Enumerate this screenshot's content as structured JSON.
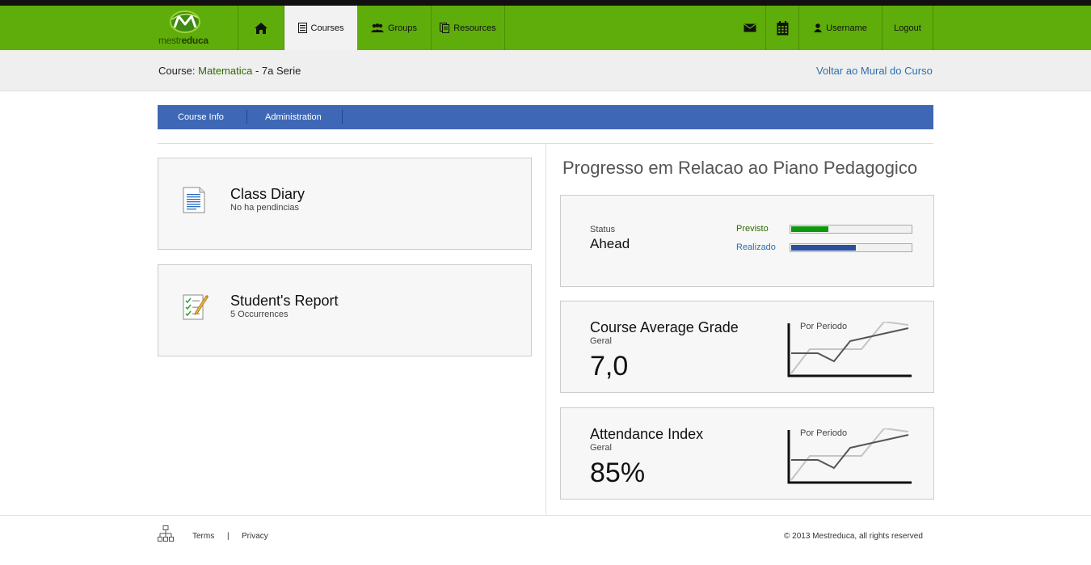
{
  "brand": {
    "logo_text_left": "mestr",
    "logo_text_right": "educa"
  },
  "nav": {
    "home_icon": "home-icon",
    "courses": "Courses",
    "groups": "Groups",
    "resources": "Resources",
    "mail_icon": "mail-icon",
    "calendar_icon": "calendar-icon",
    "username": "Username",
    "logout": "Logout"
  },
  "course": {
    "prefix": "Course:",
    "name": "Matematica",
    "suffix": "- 7a Serie",
    "back_link": "Voltar ao Mural do Curso"
  },
  "subnav": {
    "tabs": [
      "Course Info",
      "Administration"
    ]
  },
  "left_cards": [
    {
      "title": "Class Diary",
      "subtitle": "No ha pendincias",
      "icon": "document-icon"
    },
    {
      "title": "Student's Report",
      "subtitle": "5 Occurrences",
      "icon": "checklist-pencil-icon"
    }
  ],
  "progress": {
    "heading": "Progresso em Relacao ao Piano Pedagogico",
    "status_label": "Status",
    "status_value": "Ahead",
    "previsto_label": "Previsto",
    "previsto_fraction": 0.31,
    "realizado_label": "Realizado",
    "realizado_fraction": 0.54,
    "colors": {
      "previsto": "#0b9a0b",
      "realizado": "#2a4f9c",
      "previsto_text": "#2e6a00",
      "realizado_text": "#2c6fb0"
    }
  },
  "grade": {
    "title": "Course Average Grade",
    "scope": "Geral",
    "value": "7,0",
    "spark_label": "Por Periodo"
  },
  "attendance": {
    "title": "Attendance Index",
    "scope": "Geral",
    "value": "85%",
    "spark_label": "Por Periodo"
  },
  "footer": {
    "sitemap_icon": "sitemap-icon",
    "terms": "Terms",
    "separator": "|",
    "privacy": "Privacy",
    "copyright": "© 2013 Mestreduca, all rights reserved"
  }
}
